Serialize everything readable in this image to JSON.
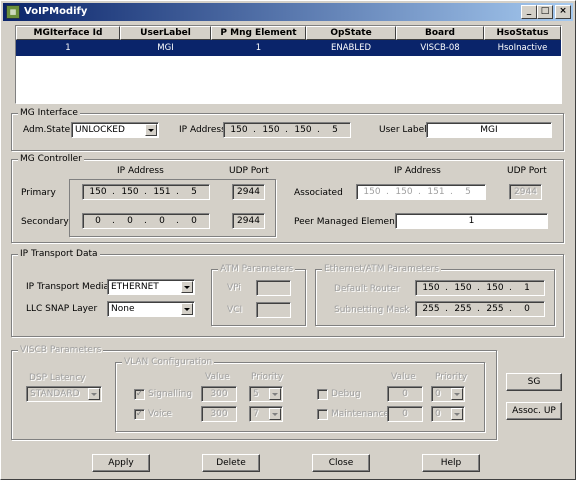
{
  "window": {
    "title": "VoIPModify"
  },
  "table": {
    "columns": [
      "MGIterface Id",
      "UserLabel",
      "P Mng Element",
      "OpState",
      "Board",
      "HsoStatus"
    ],
    "rows": [
      [
        "1",
        "MGI",
        "1",
        "ENABLED",
        "VISCB-08",
        "HsoInactive"
      ]
    ]
  },
  "mg_interface": {
    "legend": "MG Interface",
    "adm_state_label": "Adm.State",
    "adm_state_value": "UNLOCKED",
    "ip_label": "IP Address",
    "ip": [
      "150",
      "150",
      "150",
      "5"
    ],
    "user_label_label": "User Label",
    "user_label_value": "MGI"
  },
  "mg_controller": {
    "legend": "MG Controller",
    "ip_header_left": "IP Address",
    "udp_header_left": "UDP Port",
    "ip_header_right": "IP Address",
    "udp_header_right": "UDP Port",
    "primary_label": "Primary",
    "primary_ip": [
      "150",
      "150",
      "151",
      "5"
    ],
    "primary_port": "2944",
    "secondary_label": "Secondary",
    "secondary_ip": [
      "0",
      "0",
      "0",
      "0"
    ],
    "secondary_port": "2944",
    "associated_label": "Associated",
    "associated_ip": [
      "150",
      "150",
      "151",
      "5"
    ],
    "associated_port": "2944",
    "peer_label": "Peer Managed Element",
    "peer_value": "1"
  },
  "ip_transport": {
    "legend": "IP Transport Data",
    "media_label": "IP Transport Media",
    "media_value": "ETHERNET",
    "llc_label": "LLC SNAP Layer",
    "llc_value": "None",
    "atm": {
      "legend": "ATM Parameters",
      "vpi_label": "VPi",
      "vci_label": "VCI"
    },
    "eth": {
      "legend": "Ethernet/ATM Parameters",
      "router_label": "Default Router",
      "router_ip": [
        "150",
        "150",
        "150",
        "1"
      ],
      "mask_label": "Subnetting Mask",
      "mask_ip": [
        "255",
        "255",
        "255",
        "0"
      ]
    }
  },
  "viscb": {
    "legend": "VISCB Parameters",
    "dsp_label": "DSP Latency",
    "dsp_value": "STANDARD",
    "vlan_legend": "VLAN Configuration",
    "value_header": "Value",
    "priority_header": "Priority",
    "value_header2": "Value",
    "priority_header2": "Priority",
    "signalling_label": "Signalling",
    "signalling_value": "300",
    "signalling_priority": "5",
    "voice_label": "Voice",
    "voice_value": "300",
    "voice_priority": "7",
    "debug_label": "Debug",
    "debug_value": "0",
    "debug_priority": "0",
    "maintenance_label": "Maintenance",
    "maintenance_value": "0",
    "maintenance_priority": "0"
  },
  "side_buttons": {
    "sg": "SG",
    "assoc_up": "Assoc. UP"
  },
  "buttons": {
    "apply": "Apply",
    "delete": "Delete",
    "close": "Close",
    "help": "Help"
  }
}
